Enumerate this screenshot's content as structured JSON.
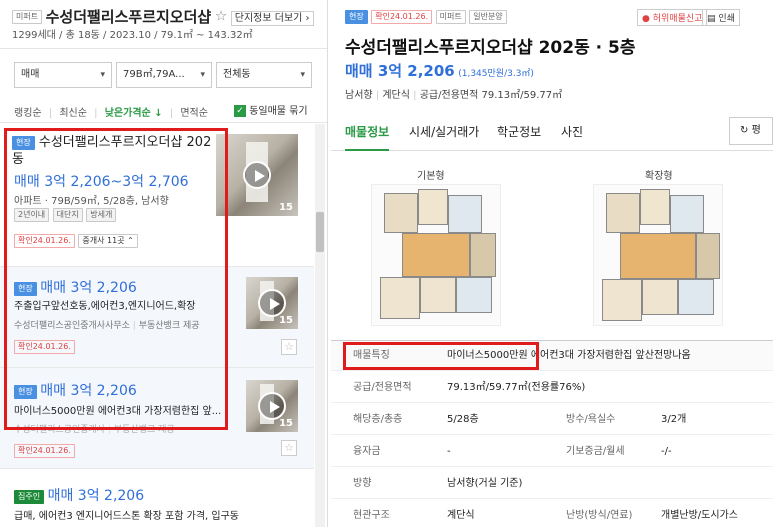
{
  "left": {
    "complex_tag": "미퍼트",
    "complex_title": "수성더팰리스푸르지오더샵",
    "star_icon": "☆",
    "detail_link": "단지정보 더보기 ›",
    "complex_meta": "1299세대 / 총 18동 / 2023.10 / 79.1㎡ ~ 143.32㎡",
    "filters": {
      "deal": "매매",
      "area": "79B㎡,79A...",
      "dong": "전체동"
    },
    "sort": {
      "rank": "랭킹순",
      "recent": "최신순",
      "low_price": "낮은가격순 ↓",
      "area": "면적순",
      "same_listing": "동일매물 묶기"
    },
    "listings": [
      {
        "tag": "현장",
        "title_line1": "수성더팰리스푸르지오더샵 202",
        "title_line2": "동",
        "price": "매매 3억 2,206~3억 2,706",
        "info": "아파트 · 79B/59㎡, 5/28층, 남서향",
        "chips": [
          "2년이내",
          "대단지",
          "방세개"
        ],
        "confirmed": "확인24.01.26.",
        "brokers": "중개사 11곳 ⌃",
        "photo_count": "15"
      },
      {
        "tag": "현장",
        "price": "매매 3억 2,206",
        "desc": "주출입구앞선호동,에어컨3,엔지니어드,확장",
        "agency": "수성더팰리스공인중개사사무소",
        "provider": "부동산뱅크 제공",
        "confirmed": "확인24.01.26.",
        "photo_count": "15"
      },
      {
        "tag": "현장",
        "price": "매매 3억 2,206",
        "desc": "마이너스5000만원 에어컨3대 가장저렴한집 앞...",
        "agency": "수성더팰리스공인중개사",
        "provider": "부동산뱅크 제공",
        "confirmed": "확인24.01.26.",
        "photo_count": "15"
      },
      {
        "tag": "집주인",
        "price": "매매 3억 2,206",
        "desc": "급매, 에어컨3 엔지니어드스톤 확장 포함 가격, 입구동"
      }
    ]
  },
  "right": {
    "tags": [
      "현장",
      "확인24.01.26.",
      "미퍼트",
      "일반분양"
    ],
    "report_btn": "허위매물신고",
    "print_btn": "인쇄",
    "title": "수성더팰리스푸르지오더샵 202동 · 5층",
    "price": "매매 3억 2,206",
    "price_unit": "(1,345만원/3.3㎡)",
    "facts": [
      "남서향",
      "계단식",
      "공급/전용면적 79.13㎡/59.77㎡"
    ],
    "tabs": [
      "매물정보",
      "시세/실거래가",
      "학군정보",
      "사진"
    ],
    "tab_right": "평",
    "floorplan_labels": [
      "기본형",
      "확장형"
    ],
    "rows": [
      {
        "k": "매물특징",
        "v": "마이너스5000만원 에어컨3대 가장저렴한집 앞산전망나옴"
      },
      {
        "k": "공급/전용면적",
        "v": "79.13㎡/59.77㎡(전용률76%)"
      },
      {
        "k": "해당층/총층",
        "v": "5/28층",
        "k2": "방수/욕실수",
        "v2": "3/2개"
      },
      {
        "k": "융자금",
        "v": "-",
        "k2": "기보증금/월세",
        "v2": "-/-"
      },
      {
        "k": "방향",
        "v": "남서향(거실 기준)"
      },
      {
        "k": "현관구조",
        "v": "계단식",
        "k2": "난방(방식/연료)",
        "v2": "개별난방/도시가스"
      }
    ]
  }
}
